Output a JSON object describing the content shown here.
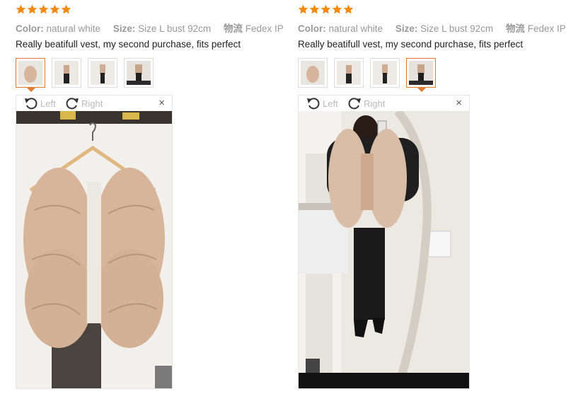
{
  "reviews": [
    {
      "rating": 5,
      "color_label": "Color:",
      "color_value": "natural white",
      "size_label": "Size:",
      "size_value": "Size L bust 92cm",
      "shipping_label": "物流",
      "shipping_value": "Fedex IP",
      "comment": "Really beatifull vest, my second purchase, fits perfect",
      "thumbnails": [
        "photo-1",
        "photo-2",
        "photo-3",
        "photo-4"
      ],
      "active_thumbnail": 0,
      "viewer": {
        "rotate_left": "Left",
        "rotate_right": "Right",
        "close": "×"
      }
    },
    {
      "rating": 5,
      "color_label": "Color:",
      "color_value": "natural white",
      "size_label": "Size:",
      "size_value": "Size L bust 92cm",
      "shipping_label": "物流",
      "shipping_value": "Fedex IP",
      "comment": "Really beatifull vest, my second purchase, fits perfect",
      "thumbnails": [
        "photo-1",
        "photo-2",
        "photo-3",
        "photo-4"
      ],
      "active_thumbnail": 3,
      "viewer": {
        "rotate_left": "Left",
        "rotate_right": "Right",
        "close": "×"
      }
    }
  ],
  "colors": {
    "star": "#f5890a",
    "active_border": "#e07a30",
    "muted_text": "#999999",
    "vest": "#d9b8a0"
  }
}
